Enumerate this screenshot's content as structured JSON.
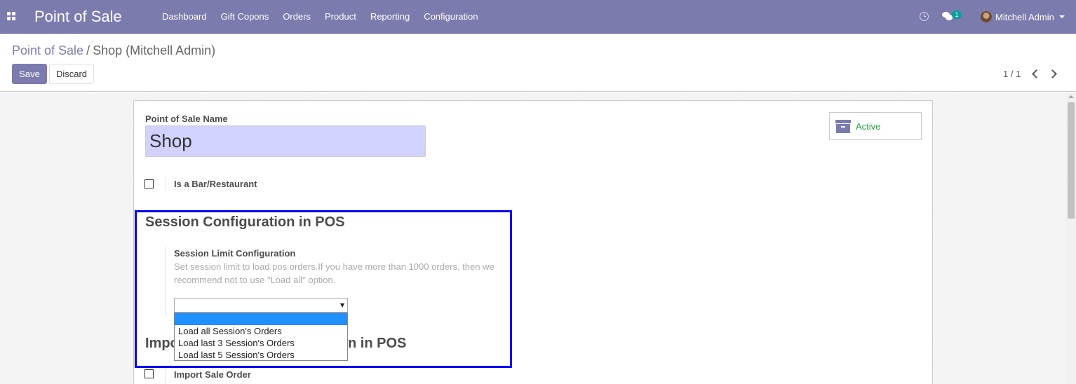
{
  "navbar": {
    "app_title": "Point of Sale",
    "menu": [
      "Dashboard",
      "Gift Copons",
      "Orders",
      "Product",
      "Reporting",
      "Configuration"
    ],
    "message_count": "1",
    "user_name": "Mitchell Admin",
    "accent_color": "#7c7bad"
  },
  "control_panel": {
    "breadcrumb_parent": "Point of Sale",
    "breadcrumb_separator": "/",
    "breadcrumb_current": "Shop (Mitchell Admin)",
    "save_label": "Save",
    "discard_label": "Discard",
    "pager": "1 / 1"
  },
  "form": {
    "name_label": "Point of Sale Name",
    "name_value": "Shop",
    "active_label": "Active",
    "is_bar_label": "Is a Bar/Restaurant",
    "session_section_title": "Session Configuration in POS",
    "session_limit_label": "Session Limit Configuration",
    "session_limit_help": "Set session limit to load pos orders.If you have more than 1000 orders, then we recommend not to use \"Load all\" option.",
    "session_limit_value": "",
    "session_limit_options": [
      "",
      "Load all Session's Orders",
      "Load last 3 Session's Orders",
      "Load last 5 Session's Orders"
    ],
    "import_section_title_start": "Impo",
    "import_section_title_end": "n in POS",
    "import_sale_order_label": "Import Sale Order"
  },
  "icons": {
    "apps": "apps-grid-icon",
    "activity": "clock-icon",
    "messages": "chat-icon",
    "archive": "archive-icon"
  }
}
